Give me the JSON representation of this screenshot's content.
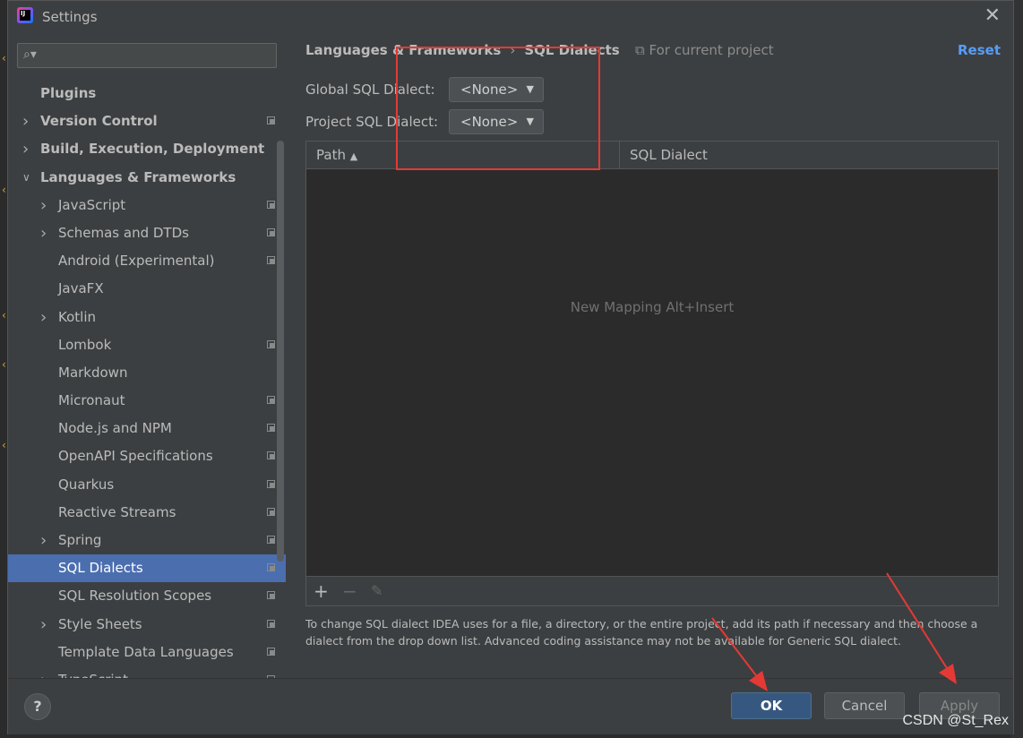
{
  "window": {
    "title": "Settings"
  },
  "sidebar": {
    "search_placeholder": "",
    "items": [
      {
        "label": "Plugins",
        "level": 0,
        "expand": "none",
        "bold": true,
        "project_icon": false
      },
      {
        "label": "Version Control",
        "level": 0,
        "expand": "collapsed",
        "bold": true,
        "project_icon": true
      },
      {
        "label": "Build, Execution, Deployment",
        "level": 0,
        "expand": "collapsed",
        "bold": true,
        "project_icon": false
      },
      {
        "label": "Languages & Frameworks",
        "level": 0,
        "expand": "expanded",
        "bold": true,
        "project_icon": false
      },
      {
        "label": "JavaScript",
        "level": 1,
        "expand": "collapsed",
        "project_icon": true
      },
      {
        "label": "Schemas and DTDs",
        "level": 1,
        "expand": "collapsed",
        "project_icon": true
      },
      {
        "label": "Android (Experimental)",
        "level": 1,
        "expand": "none",
        "project_icon": true
      },
      {
        "label": "JavaFX",
        "level": 1,
        "expand": "none",
        "project_icon": false
      },
      {
        "label": "Kotlin",
        "level": 1,
        "expand": "collapsed",
        "project_icon": false
      },
      {
        "label": "Lombok",
        "level": 1,
        "expand": "none",
        "project_icon": true
      },
      {
        "label": "Markdown",
        "level": 1,
        "expand": "none",
        "project_icon": false
      },
      {
        "label": "Micronaut",
        "level": 1,
        "expand": "none",
        "project_icon": true
      },
      {
        "label": "Node.js and NPM",
        "level": 1,
        "expand": "none",
        "project_icon": true
      },
      {
        "label": "OpenAPI Specifications",
        "level": 1,
        "expand": "none",
        "project_icon": true
      },
      {
        "label": "Quarkus",
        "level": 1,
        "expand": "none",
        "project_icon": true
      },
      {
        "label": "Reactive Streams",
        "level": 1,
        "expand": "none",
        "project_icon": true
      },
      {
        "label": "Spring",
        "level": 1,
        "expand": "collapsed",
        "project_icon": true
      },
      {
        "label": "SQL Dialects",
        "level": 1,
        "expand": "none",
        "project_icon": true,
        "selected": true
      },
      {
        "label": "SQL Resolution Scopes",
        "level": 1,
        "expand": "none",
        "project_icon": true
      },
      {
        "label": "Style Sheets",
        "level": 1,
        "expand": "collapsed",
        "project_icon": true
      },
      {
        "label": "Template Data Languages",
        "level": 1,
        "expand": "none",
        "project_icon": true
      },
      {
        "label": "TypeScript",
        "level": 1,
        "expand": "collapsed",
        "project_icon": true
      }
    ]
  },
  "main": {
    "breadcrumb": {
      "parent": "Languages & Frameworks",
      "current": "SQL Dialects"
    },
    "scope_label": "For current project",
    "reset_label": "Reset",
    "global_label": "Global SQL Dialect:",
    "global_value": "<None>",
    "project_label": "Project SQL Dialect:",
    "project_value": "<None>",
    "table": {
      "col_path": "Path",
      "col_dialect": "SQL Dialect",
      "empty_text": "New Mapping Alt+Insert"
    },
    "help_text": "To change SQL dialect IDEA uses for a file, a directory, or the entire project, add its path if necessary and then choose a dialect from the drop down list. Advanced coding assistance may not be available for Generic SQL dialect."
  },
  "footer": {
    "help_label": "?",
    "ok_label": "OK",
    "cancel_label": "Cancel",
    "apply_label": "Apply"
  },
  "watermark": "CSDN @St_Rex",
  "colors": {
    "selection": "#4b6eaf",
    "link": "#589df6",
    "ok": "#365880",
    "annotation": "#e53935"
  }
}
